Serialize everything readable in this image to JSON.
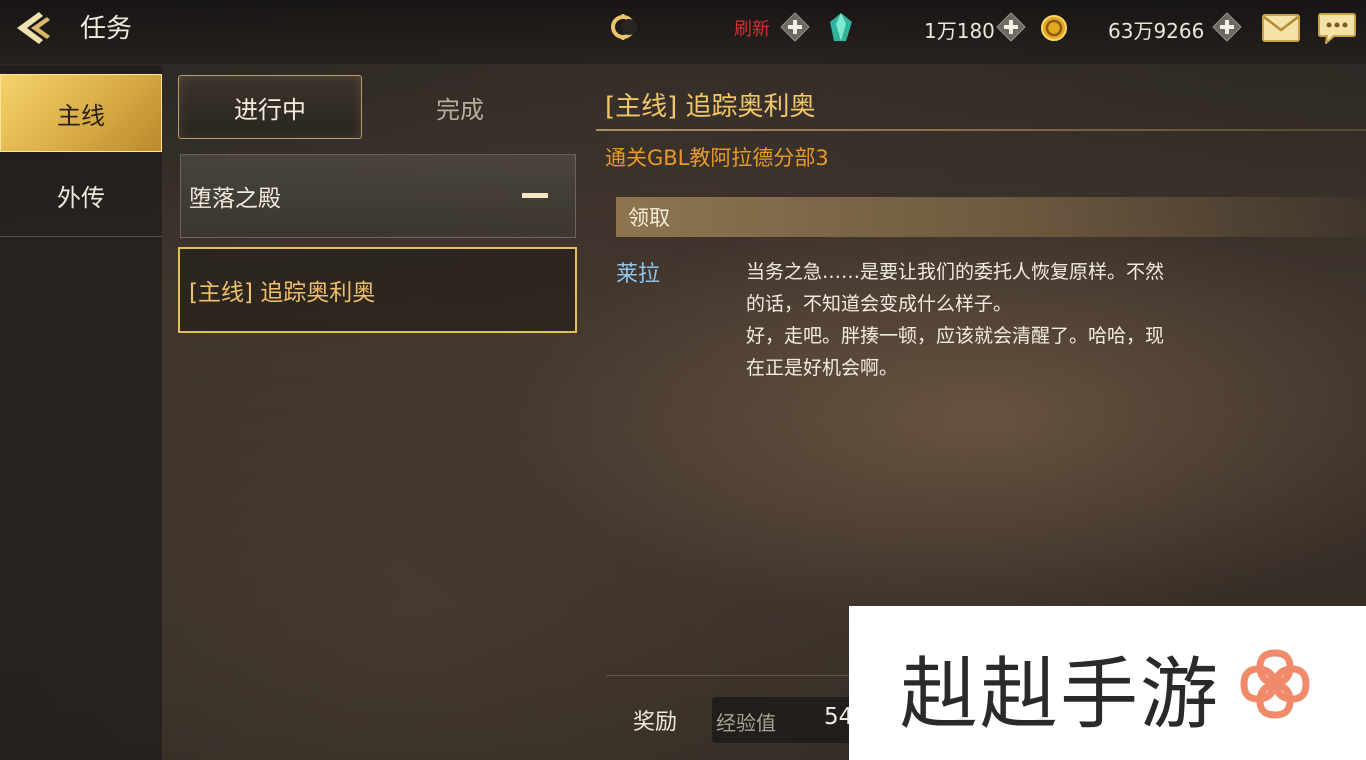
{
  "header": {
    "title": "任务",
    "refresh_label": "刷新",
    "diamond_amount": "1万180",
    "gold_amount": "63万9266"
  },
  "categories": [
    {
      "label": "主线",
      "selected": true
    },
    {
      "label": "外传",
      "selected": false
    }
  ],
  "status_tabs": [
    {
      "label": "进行中",
      "selected": true
    },
    {
      "label": "完成",
      "selected": false
    }
  ],
  "quest_list": {
    "group_label": "堕落之殿",
    "items": [
      {
        "label": "[主线] 追踪奥利奥",
        "selected": true
      }
    ]
  },
  "detail": {
    "title": "[主线] 追踪奥利奥",
    "objective": "通关GBL教阿拉德分部3",
    "claim_label": "领取",
    "speaker": "莱拉",
    "dialogue_lines": [
      "当务之急……是要让我们的委托人恢复原样。不然",
      "的话，不知道会变成什么样子。",
      "好，走吧。胖揍一顿，应该就会清醒了。哈哈，现",
      "在正是好机会啊。"
    ]
  },
  "reward": {
    "label": "奖励",
    "item_name": "经验值",
    "item_value": "54"
  },
  "watermark": {
    "text": "赳赳手游"
  },
  "colors": {
    "accent_gold": "#f2c66a",
    "objective_orange": "#e79a28",
    "speaker_blue": "#8ec6f0",
    "refresh_red": "#d03030"
  }
}
